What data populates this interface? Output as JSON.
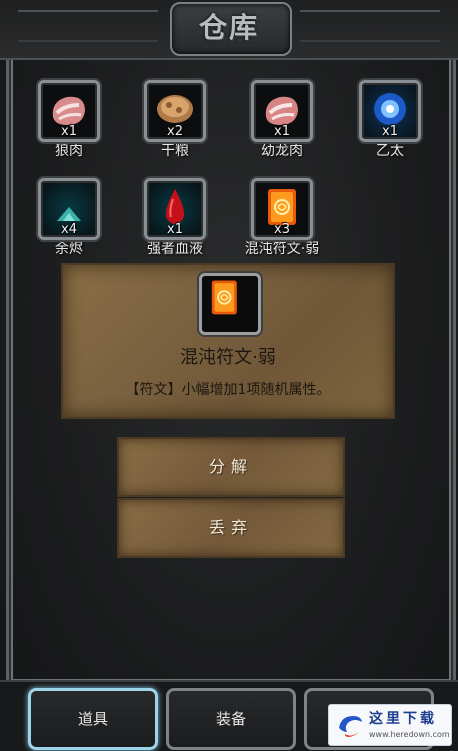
{
  "header": {
    "title": "仓库"
  },
  "inventory": [
    {
      "name": "狼肉",
      "qty": "x1",
      "icon": "raw-meat-icon"
    },
    {
      "name": "干粮",
      "qty": "x2",
      "icon": "dry-ration-icon"
    },
    {
      "name": "幼龙肉",
      "qty": "x1",
      "icon": "dragon-meat-icon"
    },
    {
      "name": "乙太",
      "qty": "x1",
      "icon": "aether-orb-icon"
    },
    {
      "name": "余烬",
      "qty": "x4",
      "icon": "ember-icon"
    },
    {
      "name": "强者血液",
      "qty": "x1",
      "icon": "blood-drop-icon"
    },
    {
      "name": "混沌符文·弱",
      "qty": "x3",
      "icon": "chaos-rune-icon"
    }
  ],
  "detail": {
    "name": "混沌符文·弱",
    "description": "【符文】小幅增加1项随机属性。",
    "icon": "chaos-rune-icon"
  },
  "actions": {
    "decompose_label": "分解",
    "discard_label": "丢弃"
  },
  "tabs": [
    {
      "label": "道具",
      "active": true
    },
    {
      "label": "装备",
      "active": false
    },
    {
      "label": "",
      "active": false
    }
  ],
  "watermark": {
    "text": "这里下载",
    "url": "www.heredown.com"
  },
  "colors": {
    "parchment": "#7b6240",
    "slot_border": "#8a8f93",
    "active_tab": "#9fd3e8"
  }
}
